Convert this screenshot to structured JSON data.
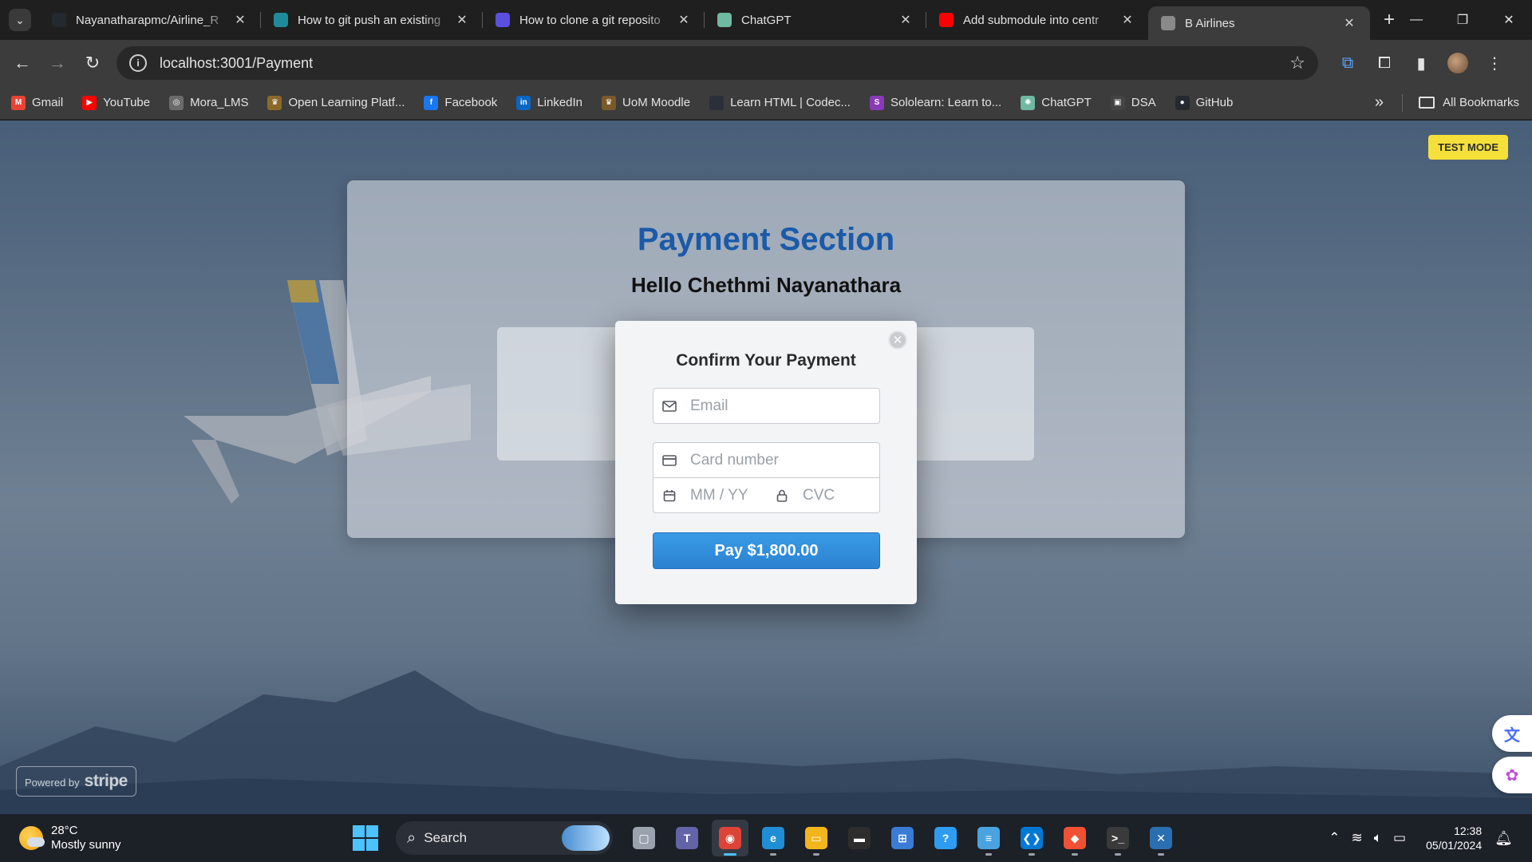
{
  "browser": {
    "tabs": [
      {
        "title": "Nayanatharapmc/Airline_R",
        "icon": "github-icon",
        "color": "#24292f"
      },
      {
        "title": "How to git push an existing",
        "icon": "eye-icon",
        "color": "#1f8a9a"
      },
      {
        "title": "How to clone a git reposito",
        "icon": "terminal-icon",
        "color": "#5b4fe0"
      },
      {
        "title": "ChatGPT",
        "icon": "chatgpt-icon",
        "color": "#6fb8a1"
      },
      {
        "title": "Add submodule into centr",
        "icon": "youtube-icon",
        "color": "#ff0000"
      },
      {
        "title": "B Airlines",
        "icon": "globe-icon",
        "color": "#8a8a8a"
      }
    ],
    "address": {
      "url": "localhost:3001/Payment"
    },
    "bookmarks": [
      {
        "label": "Gmail",
        "icon": "gmail-icon",
        "color": "#ea4335",
        "glyph": "M"
      },
      {
        "label": "YouTube",
        "icon": "youtube-icon",
        "color": "#ff0000",
        "glyph": "▶"
      },
      {
        "label": "Mora_LMS",
        "icon": "globe-icon",
        "color": "#6b6b6b",
        "glyph": "◎"
      },
      {
        "label": "Open Learning Platf...",
        "icon": "open-learning-icon",
        "color": "#8a6a2a",
        "glyph": "♛"
      },
      {
        "label": "Facebook",
        "icon": "facebook-icon",
        "color": "#1877f2",
        "glyph": "f"
      },
      {
        "label": "LinkedIn",
        "icon": "linkedin-icon",
        "color": "#0a66c2",
        "glyph": "in"
      },
      {
        "label": "UoM Moodle",
        "icon": "moodle-icon",
        "color": "#7a5a2a",
        "glyph": "♛"
      },
      {
        "label": "Learn HTML | Codec...",
        "icon": "codecademy-icon",
        "color": "#2a2f3a",
        "glyph": ""
      },
      {
        "label": "Sololearn: Learn to...",
        "icon": "sololearn-icon",
        "color": "#8a3ab9",
        "glyph": "S"
      },
      {
        "label": "ChatGPT",
        "icon": "chatgpt-icon",
        "color": "#6fb8a1",
        "glyph": "✺"
      },
      {
        "label": "DSA",
        "icon": "dsa-icon",
        "color": "#444444",
        "glyph": "▣"
      },
      {
        "label": "GitHub",
        "icon": "github-icon",
        "color": "#24292f",
        "glyph": "●"
      }
    ],
    "all_bookmarks_label": "All Bookmarks"
  },
  "page": {
    "test_mode_label": "TEST MODE",
    "heading": "Payment Section",
    "greeting": "Hello Chethmi Nayanathara",
    "powered_by": "Powered by",
    "stripe_brand": "stripe",
    "heading_color": "#1a5aa8"
  },
  "modal": {
    "title": "Confirm Your Payment",
    "email_placeholder": "Email",
    "card_placeholder": "Card number",
    "expiry_placeholder": "MM / YY",
    "cvc_placeholder": "CVC",
    "pay_label": "Pay $1,800.00",
    "accent_color": "#2b82d0"
  },
  "taskbar": {
    "temperature": "28°C",
    "weather": "Mostly sunny",
    "search_label": "Search",
    "time": "12:38",
    "date": "05/01/2024",
    "apps": [
      {
        "name": "task-view-app",
        "color": "#9aa3ad",
        "glyph": "▢"
      },
      {
        "name": "teams-app",
        "color": "#6264a7",
        "glyph": "T"
      },
      {
        "name": "chrome-app",
        "color": "#db4437",
        "glyph": "◉",
        "active": true
      },
      {
        "name": "edge-app",
        "color": "#1f8ed6",
        "glyph": "e"
      },
      {
        "name": "file-explorer-app",
        "color": "#f2b51c",
        "glyph": "▭"
      },
      {
        "name": "terminal-app",
        "color": "#2d2d2d",
        "glyph": "▬"
      },
      {
        "name": "store-app",
        "color": "#3a7bd5",
        "glyph": "⊞"
      },
      {
        "name": "help-app",
        "color": "#2e9cf0",
        "glyph": "?"
      },
      {
        "name": "notepad-app",
        "color": "#4aa3df",
        "glyph": "≡"
      },
      {
        "name": "vscode-app",
        "color": "#0078d4",
        "glyph": "❮❯"
      },
      {
        "name": "git-app",
        "color": "#f05033",
        "glyph": "◆"
      },
      {
        "name": "cmd-app",
        "color": "#3a3a3a",
        "glyph": ">_"
      },
      {
        "name": "ssms-app",
        "color": "#2a6fb0",
        "glyph": "✕"
      }
    ]
  }
}
